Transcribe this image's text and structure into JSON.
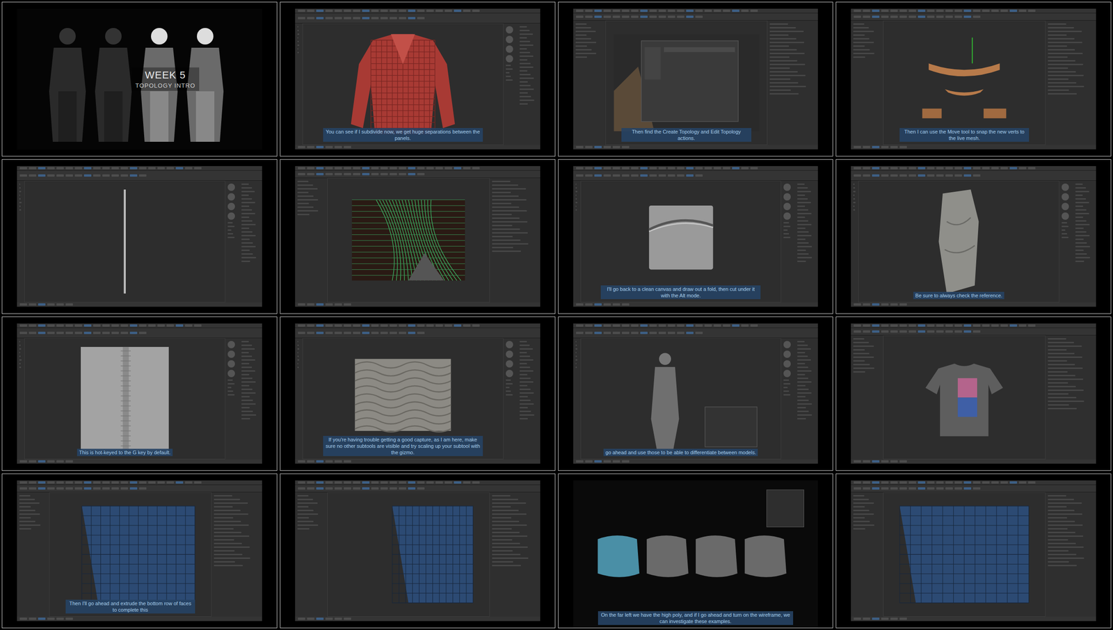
{
  "frames": [
    {
      "kind": "title",
      "scene": "characters",
      "heading": "WEEK 5",
      "subheading": "TOPOLOGY INTRO"
    },
    {
      "kind": "zbrush",
      "scene": "jacket",
      "subtitle": "You can see if I subdivide now, we get huge separations between the panels."
    },
    {
      "kind": "maya",
      "scene": "dialog",
      "subtitle": "Then find the Create Topology and Edit Topology actions."
    },
    {
      "kind": "maya",
      "scene": "strips",
      "subtitle": "Then I can use the Move tool to snap the new verts to the live mesh."
    },
    {
      "kind": "zbrush",
      "scene": "line",
      "subtitle": ""
    },
    {
      "kind": "maya",
      "scene": "wireframe",
      "subtitle": ""
    },
    {
      "kind": "zbrush",
      "scene": "fold",
      "subtitle": "I'll go back to a clean canvas and draw out a fold, then cut under it with the Alt mode."
    },
    {
      "kind": "zbrush",
      "scene": "tube",
      "subtitle": "Be sure to always check the reference."
    },
    {
      "kind": "zbrush",
      "scene": "seam",
      "subtitle": "This is hot-keyed to the G key by default."
    },
    {
      "kind": "zbrush",
      "scene": "wrinkles",
      "subtitle": "If you're having trouble getting a good capture, as I am here, make sure no other subtools are visible and try scaling up your subtool with the gizmo."
    },
    {
      "kind": "zbrush",
      "scene": "figure",
      "subtitle": "go ahead and use those to be able to differentiate between models."
    },
    {
      "kind": "maya",
      "scene": "tshirt",
      "subtitle": ""
    },
    {
      "kind": "maya",
      "scene": "sleeve",
      "subtitle": "Then I'll go ahead and extrude the bottom row of faces to complete this"
    },
    {
      "kind": "maya",
      "scene": "sleeve2",
      "subtitle": ""
    },
    {
      "kind": "preview",
      "scene": "blobs",
      "subtitle": "On the far left we have the high poly, and if I go ahead and turn on the wireframe, we can investigate these examples."
    },
    {
      "kind": "maya",
      "scene": "closeup",
      "subtitle": ""
    }
  ]
}
